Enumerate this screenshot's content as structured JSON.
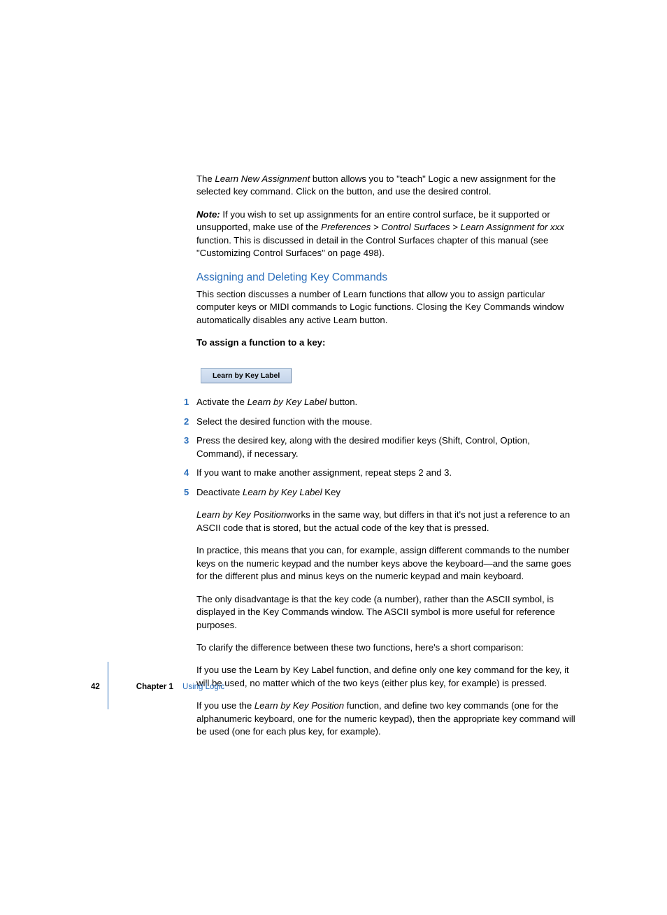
{
  "page_number": "42",
  "chapter_label": "Chapter 1",
  "chapter_title": "Using Logic",
  "intro": {
    "p1_a": "The ",
    "p1_i": "Learn New Assignment",
    "p1_b": " button allows you to \"teach\" Logic a new assignment for the selected key command. Click on the button, and use the desired control.",
    "note_label": "Note:",
    "note_a": "  If you wish to set up assignments for an entire control surface, be it supported or unsupported, make use of the ",
    "note_i": "Preferences > Control Surfaces > Learn Assignment for xxx",
    "note_b": " function. This is discussed in detail in the Control Surfaces chapter of this manual (see \"Customizing Control Surfaces\" on page 498)."
  },
  "section": {
    "heading": "Assigning and Deleting Key Commands",
    "p1": "This section discusses a number of Learn functions that allow you to assign particular computer keys or MIDI commands to Logic functions. Closing the Key Commands window automatically disables any active Learn button.",
    "subhead": "To assign a function to a key:",
    "button_label": "Learn by Key Label",
    "steps": {
      "s1_a": "Activate the ",
      "s1_i": "Learn by Key Label",
      "s1_b": " button.",
      "s2": "Select the desired function with the mouse.",
      "s3": "Press the desired key, along with the desired modifier keys (Shift, Control, Option, Command), if necessary.",
      "s4": "If you want to make another assignment, repeat steps 2 and 3.",
      "s5_a": "Deactivate ",
      "s5_i": "Learn by Key Label",
      "s5_b": " Key"
    },
    "post": {
      "p1_i": "Learn by Key Position",
      "p1_b": "works in the same way, but differs in that it's not just a reference to an ASCII code that is stored, but the actual code of the key that is pressed.",
      "p2": "In practice, this means that you can, for example, assign different commands to the number keys on the numeric keypad and the number keys above the keyboard—and the same goes for the different plus and minus keys on the numeric keypad and main keyboard.",
      "p3": "The only disadvantage is that the key code (a number), rather than the ASCII symbol, is displayed in the Key Commands window. The ASCII symbol is more useful for reference purposes.",
      "p4": "To clarify the difference between these two functions, here's a short comparison:",
      "p5": "If you use the Learn by Key Label function, and define only one key command for the key, it will be used, no matter which of the two keys (either plus key, for example) is pressed.",
      "p6_a": "If you use the ",
      "p6_i": "Learn by Key Position",
      "p6_b": " function, and define two key commands (one for the alphanumeric keyboard, one for the numeric keypad), then the appropriate key command will be used (one for each plus key, for example)."
    }
  }
}
